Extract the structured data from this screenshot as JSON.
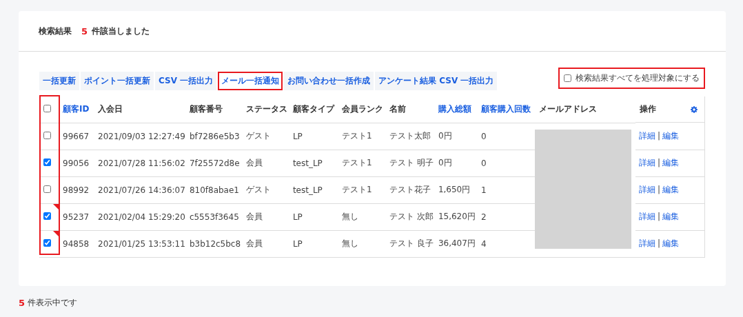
{
  "header": {
    "title": "検索結果",
    "count": "5",
    "count_suffix": "件該当しました"
  },
  "actions": [
    {
      "label": "一括更新",
      "highlighted": false
    },
    {
      "label": "ポイント一括更新",
      "highlighted": false
    },
    {
      "label": "CSV 一括出力",
      "highlighted": false
    },
    {
      "label": "メール一括通知",
      "highlighted": true
    },
    {
      "label": "お問い合わせ一括作成",
      "highlighted": false
    },
    {
      "label": "アンケート結果 CSV 一括出力",
      "highlighted": false
    }
  ],
  "select_all_results": {
    "label": "検索結果すべてを処理対象にする",
    "checked": false,
    "highlighted": true
  },
  "table": {
    "checkbox_column_highlighted": true,
    "header_checked": false,
    "email_redacted": true,
    "columns": [
      {
        "label": "顧客ID",
        "sortable": true
      },
      {
        "label": "入会日",
        "sortable": false
      },
      {
        "label": "顧客番号",
        "sortable": false
      },
      {
        "label": "ステータス",
        "sortable": false
      },
      {
        "label": "顧客タイプ",
        "sortable": false
      },
      {
        "label": "会員ランク",
        "sortable": false
      },
      {
        "label": "名前",
        "sortable": false
      },
      {
        "label": "購入総額",
        "sortable": true
      },
      {
        "label": "顧客購入回数",
        "sortable": true
      },
      {
        "label": "メールアドレス",
        "sortable": false
      },
      {
        "label": "操作",
        "sortable": false
      }
    ],
    "rows": [
      {
        "checked": false,
        "flagged": false,
        "cells": [
          "99667",
          "2021/09/03 12:27:49",
          "bf7286e5b3",
          "ゲスト",
          "LP",
          "テスト1",
          "テスト太郎",
          "0円",
          "0"
        ],
        "links": [
          "詳細",
          "編集"
        ],
        "separator": "|"
      },
      {
        "checked": true,
        "flagged": false,
        "cells": [
          "99056",
          "2021/07/28 11:56:02",
          "7f25572d8e",
          "会員",
          "test_LP",
          "テスト1",
          "テスト 明子",
          "0円",
          "0"
        ],
        "links": [
          "詳細",
          "編集"
        ],
        "separator": "|"
      },
      {
        "checked": false,
        "flagged": false,
        "cells": [
          "98992",
          "2021/07/26 14:36:07",
          "810f8abae1",
          "ゲスト",
          "test_LP",
          "テスト1",
          "テスト花子",
          "1,650円",
          "1"
        ],
        "links": [
          "詳細",
          "編集"
        ],
        "separator": "|"
      },
      {
        "checked": true,
        "flagged": true,
        "cells": [
          "95237",
          "2021/02/04 15:29:20",
          "c5553f3645",
          "会員",
          "LP",
          "無し",
          "テスト 次郎",
          "15,620円",
          "2"
        ],
        "links": [
          "詳細",
          "編集"
        ],
        "separator": "|"
      },
      {
        "checked": true,
        "flagged": true,
        "cells": [
          "94858",
          "2021/01/25 13:53:11",
          "b3b12c5bc8",
          "会員",
          "LP",
          "無し",
          "テスト 良子",
          "36,407円",
          "4"
        ],
        "links": [
          "詳細",
          "編集"
        ],
        "separator": "|"
      }
    ]
  },
  "footer": {
    "count": "5",
    "count_suffix": "件表示中です"
  }
}
